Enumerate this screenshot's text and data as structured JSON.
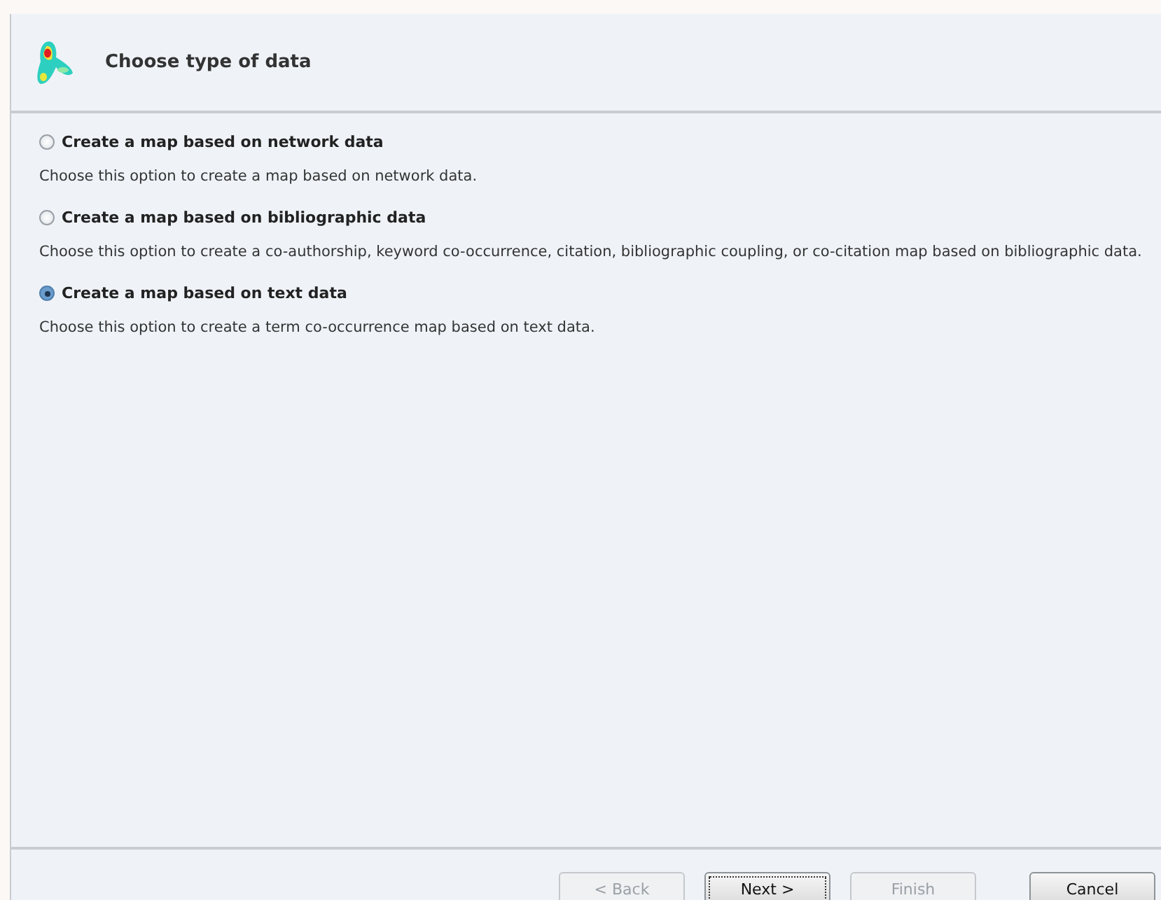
{
  "header": {
    "title": "Choose type of data"
  },
  "options": [
    {
      "label": "Create a map based on network data",
      "description": "Choose this option to create a map based on network data.",
      "selected": false
    },
    {
      "label": "Create a map based on bibliographic data",
      "description": "Choose this option to create a co-authorship, keyword co-occurrence, citation, bibliographic coupling, or co-citation map based on bibliographic data.",
      "selected": false
    },
    {
      "label": "Create a map based on text data",
      "description": "Choose this option to create a term co-occurrence map based on text data.",
      "selected": true
    }
  ],
  "buttons": [
    {
      "label": "< Back",
      "disabled": true,
      "focused": false
    },
    {
      "label": "Next >",
      "disabled": false,
      "focused": true
    },
    {
      "label": "Finish",
      "disabled": true,
      "focused": false
    },
    {
      "label": "Cancel",
      "disabled": false,
      "focused": false
    }
  ]
}
